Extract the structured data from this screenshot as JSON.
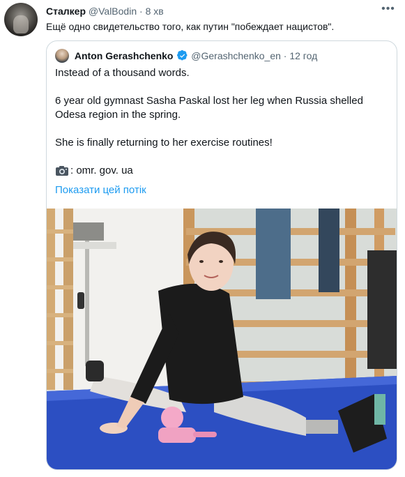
{
  "tweet": {
    "author_name": "Сталкер",
    "author_handle": "@ValBodin",
    "separator": "·",
    "time": "8 хв",
    "text": "Ещё одно свидетельство того, как путин \"побеждает нацистов\"."
  },
  "quoted": {
    "author_name": "Anton Gerashchenko",
    "author_handle": "@Gerashchenko_en",
    "separator": "·",
    "time": "12 год",
    "paragraphs": [
      "Instead of a thousand words.",
      "6 year old gymnast Sasha Paskal lost her leg when Russia shelled Odesa region in the spring.",
      "She is finally returning to her exercise routines!"
    ],
    "photo_credit": ": omr. gov. ua",
    "show_thread": "Показати цей потік"
  },
  "icons": {
    "more": "more-icon",
    "verified": "verified-badge-icon",
    "camera": "camera-icon"
  },
  "colors": {
    "accent": "#1d9bf0",
    "secondary_text": "#536471",
    "border": "#cfd9de"
  }
}
